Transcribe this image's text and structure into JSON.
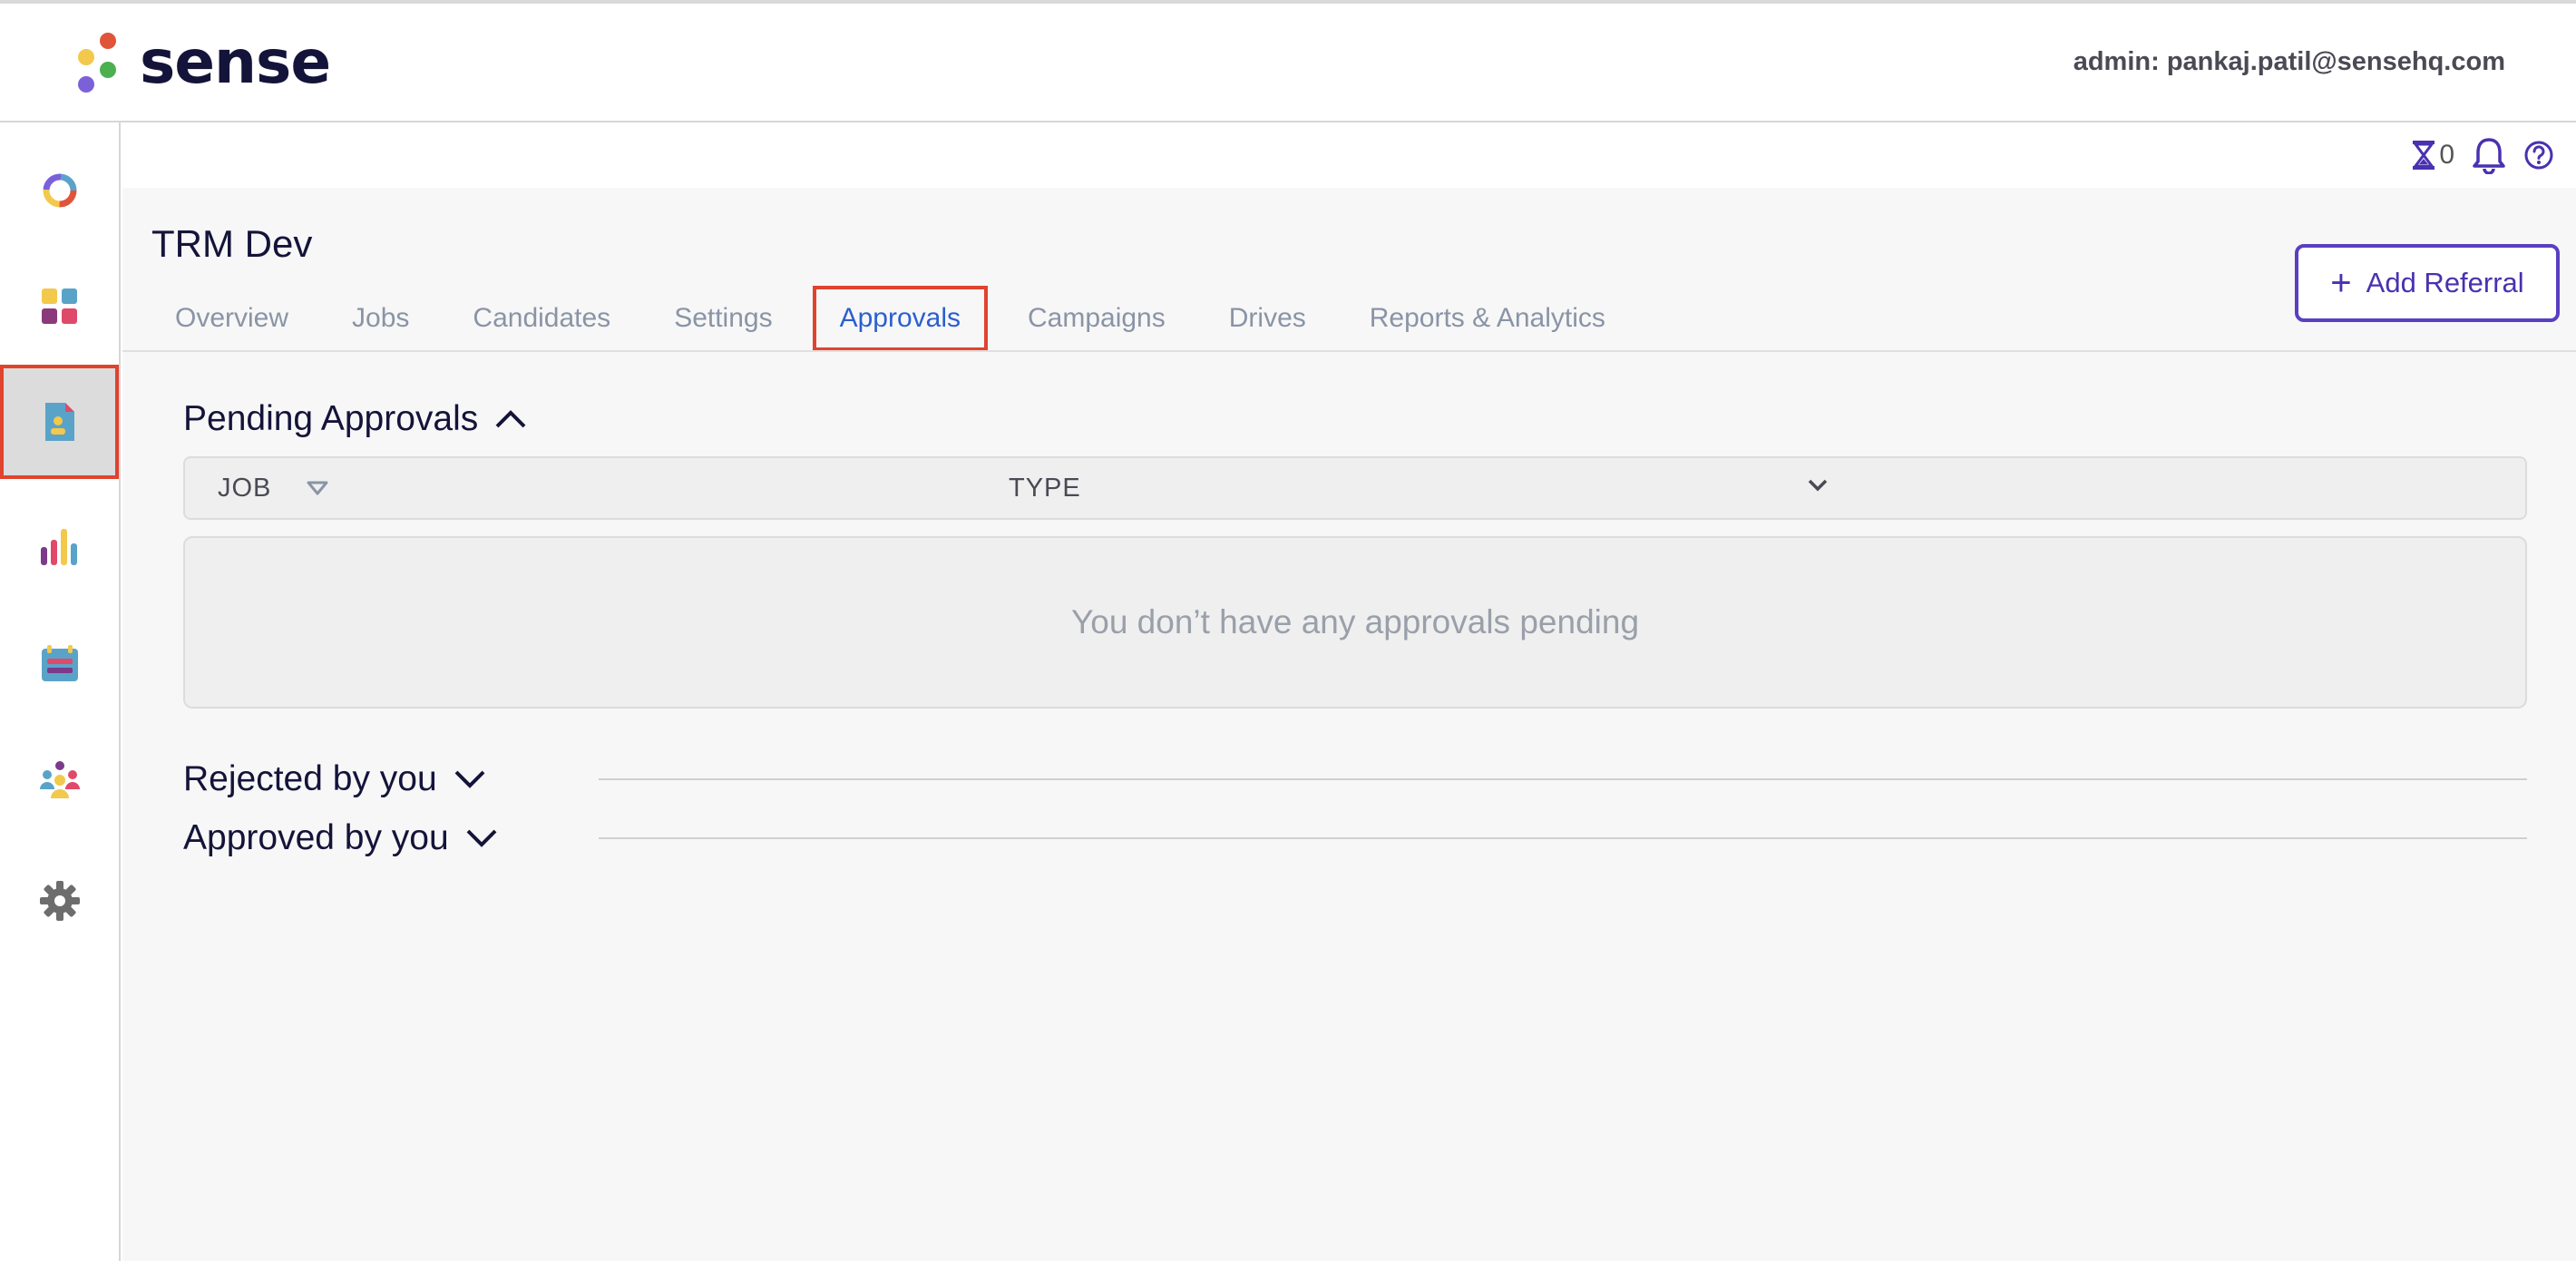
{
  "header": {
    "logo_text": "sense",
    "admin_label": "admin: pankaj.patil@sensehq.com"
  },
  "colors": {
    "accent": "#4a31b0",
    "active_tab": "#2b5fcf",
    "highlight": "#e0432e",
    "logo_dots": [
      "#e0543a",
      "#f2c94c",
      "#4caf50",
      "#7b61d9"
    ]
  },
  "sidebar": {
    "items": [
      {
        "icon": "donut-chart-icon"
      },
      {
        "icon": "dashboard-grid-icon"
      },
      {
        "icon": "referral-document-icon",
        "active": true
      },
      {
        "icon": "bar-chart-icon"
      },
      {
        "icon": "calendar-icon"
      },
      {
        "icon": "community-people-icon"
      },
      {
        "icon": "gear-icon"
      }
    ]
  },
  "utility": {
    "hourglass_count": "0",
    "icons": [
      "hourglass-icon",
      "bell-icon",
      "help-icon"
    ]
  },
  "page": {
    "title": "TRM Dev",
    "tabs": [
      {
        "label": "Overview"
      },
      {
        "label": "Jobs"
      },
      {
        "label": "Candidates"
      },
      {
        "label": "Settings"
      },
      {
        "label": "Approvals",
        "active": true
      },
      {
        "label": "Campaigns"
      },
      {
        "label": "Drives"
      },
      {
        "label": "Reports & Analytics"
      }
    ],
    "add_referral_label": "Add Referral"
  },
  "pending": {
    "title": "Pending Approvals",
    "columns": {
      "job": "JOB",
      "type": "TYPE"
    },
    "empty_message": "You don’t have any approvals pending"
  },
  "rejected": {
    "title": "Rejected by you"
  },
  "approved": {
    "title": "Approved by you"
  }
}
